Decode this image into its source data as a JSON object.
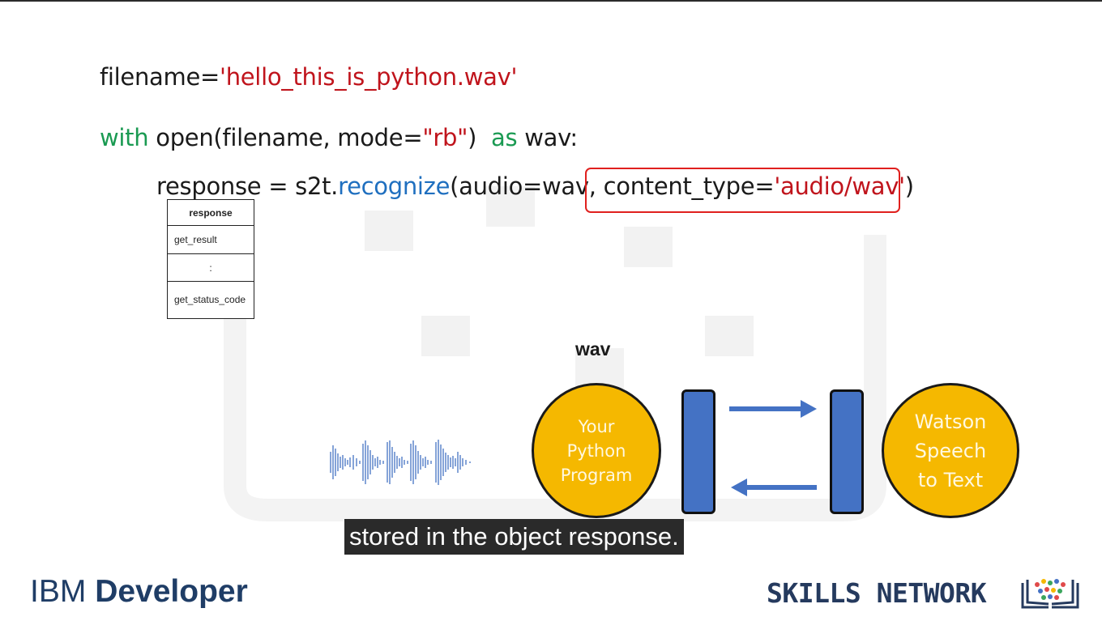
{
  "code": {
    "line1": {
      "var": "filename=",
      "value": "'hello_this_is_python.wav'"
    },
    "line2": {
      "kw_with": "with",
      "call": " open(filename, mode=",
      "mode": "\"rb\"",
      "close": ")",
      "kw_as": "as",
      "target": " wav:"
    },
    "line3": {
      "lhs": "response = s2t.",
      "fn": "recognize",
      "args": "(audio=wav, ",
      "param": "content_type=",
      "param_value": "'audio/wav'",
      "close": ")"
    }
  },
  "response_object": {
    "header": "response",
    "rows": [
      "get_result",
      ":",
      "get_status_code"
    ]
  },
  "diagram": {
    "wav_label": "wav",
    "left_circle": [
      "Your",
      "Python",
      "Program"
    ],
    "right_circle": [
      "Watson",
      "Speech",
      "to Text"
    ],
    "colors": {
      "circle": "#f5b800",
      "bar": "#4472c4",
      "arrow": "#4472c4",
      "highlight": "#e0201e"
    }
  },
  "caption": "stored in the object response.",
  "branding": {
    "ibm_prefix": "IBM",
    "ibm_suffix": "Developer",
    "skills": "SKILLS NETWORK"
  }
}
